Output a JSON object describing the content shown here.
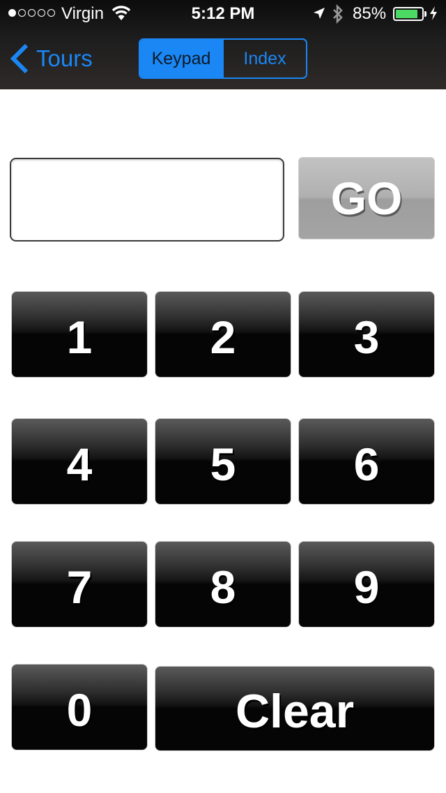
{
  "status_bar": {
    "carrier": "Virgin",
    "time": "5:12 PM",
    "battery_percent": "85%",
    "battery_level": 0.85,
    "signal_bars": 1,
    "signal_total": 5,
    "battery_color": "#4cd964"
  },
  "nav": {
    "back_label": "Tours",
    "segments": [
      "Keypad",
      "Index"
    ],
    "selected_segment": "Keypad",
    "accent_color": "#1a87f5"
  },
  "input": {
    "value": "",
    "go_label": "GO"
  },
  "keypad": {
    "keys": [
      "1",
      "2",
      "3",
      "4",
      "5",
      "6",
      "7",
      "8",
      "9",
      "0"
    ],
    "clear_label": "Clear"
  }
}
